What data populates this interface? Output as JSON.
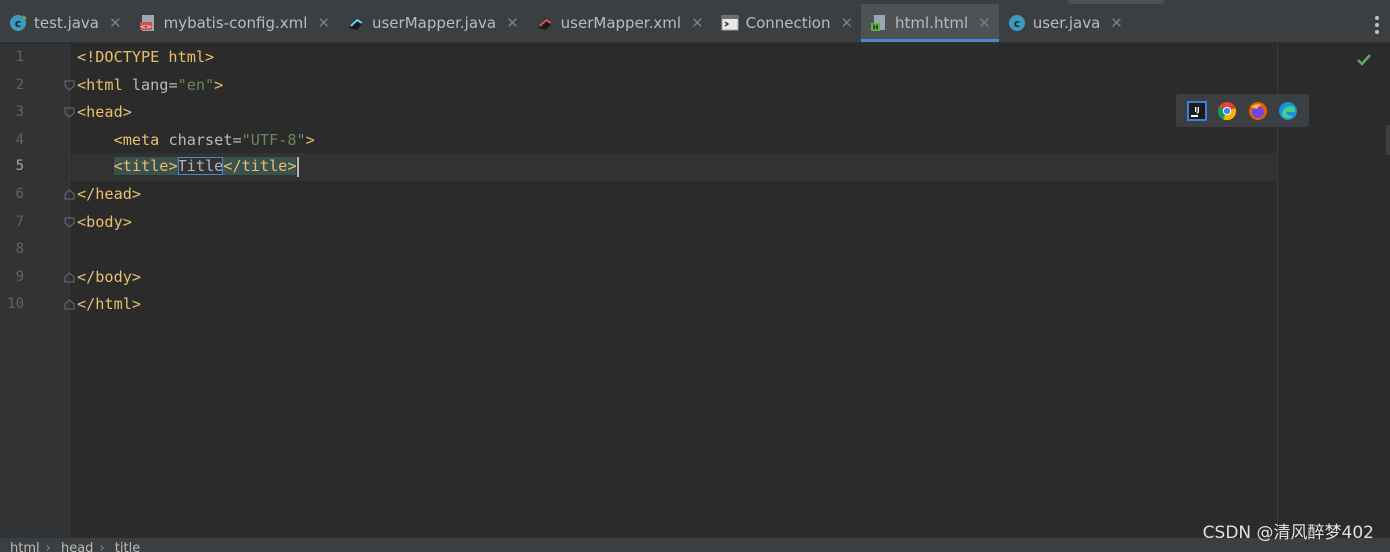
{
  "tabs": [
    {
      "label": "test.java",
      "icon": "java-class-icon",
      "active": false
    },
    {
      "label": "mybatis-config.xml",
      "icon": "xml-file-icon",
      "active": false
    },
    {
      "label": "userMapper.java",
      "icon": "mybatis-mapper-icon",
      "active": false
    },
    {
      "label": "userMapper.xml",
      "icon": "mybatis-xml-icon",
      "active": false
    },
    {
      "label": "Connection",
      "icon": "console-icon",
      "active": false
    },
    {
      "label": "html.html",
      "icon": "html-file-icon",
      "active": true
    },
    {
      "label": "user.java",
      "icon": "java-class-icon",
      "active": false
    }
  ],
  "close_glyph": "✕",
  "editor": {
    "current_line": 5,
    "lines": [
      {
        "n": "1",
        "t1": "<!DOCTYPE html>"
      },
      {
        "n": "2",
        "t1": "<html ",
        "t2": "lang=",
        "t3": "\"en\"",
        "t4": ">"
      },
      {
        "n": "3",
        "t1": "<head>"
      },
      {
        "n": "4",
        "t1": "<meta ",
        "t2": "charset=",
        "t3": "\"UTF-8\"",
        "t4": ">"
      },
      {
        "n": "5",
        "t1": "<title>",
        "t2": "Title",
        "t3": "</title>"
      },
      {
        "n": "6",
        "t1": "</head>"
      },
      {
        "n": "7",
        "t1": "<body>"
      },
      {
        "n": "8",
        "t1": ""
      },
      {
        "n": "9",
        "t1": "</body>"
      },
      {
        "n": "10",
        "t1": "</html>"
      }
    ]
  },
  "browser_icons": [
    "intellij-icon",
    "chrome-icon",
    "firefox-icon",
    "edge-icon"
  ],
  "breadcrumb": [
    "html",
    "head",
    "title"
  ],
  "breadcrumb_sep": "›",
  "watermark": "CSDN @清风醉梦402",
  "colors": {
    "tag": "#e8bf6a",
    "string": "#6a8759",
    "accent": "#4a88c7"
  }
}
